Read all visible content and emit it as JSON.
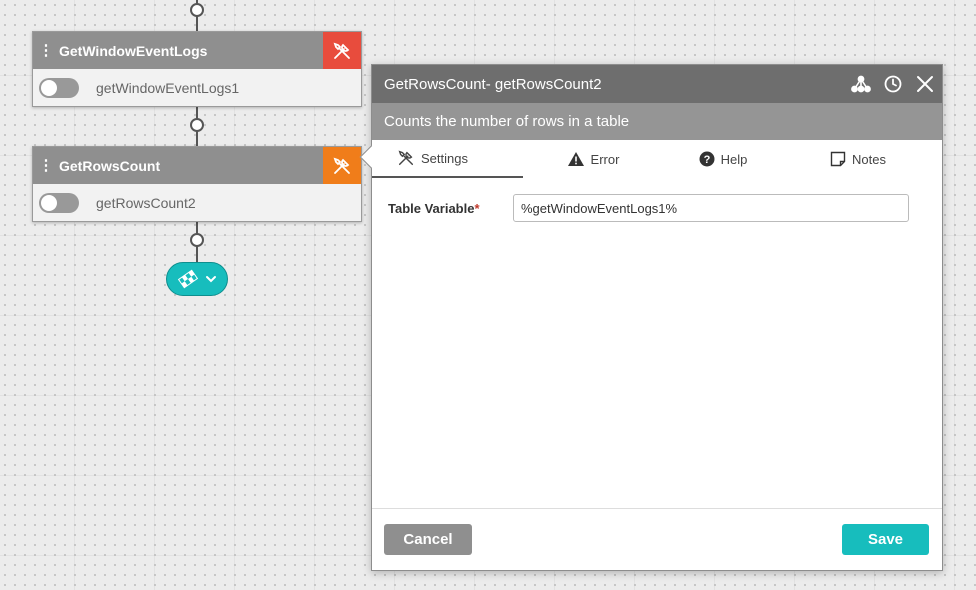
{
  "workflow": {
    "nodes": [
      {
        "title": "GetWindowEventLogs",
        "instance": "getWindowEventLogs1",
        "tool_color": "#e84c3d"
      },
      {
        "title": "GetRowsCount",
        "instance": "getRowsCount2",
        "tool_color": "#f07d1a"
      }
    ],
    "end_color": "#17bdbd"
  },
  "panel": {
    "title": "GetRowsCount-  getRowsCount2",
    "description": "Counts the number of rows in a table",
    "tabs": [
      {
        "label": "Settings",
        "icon": "tools-icon"
      },
      {
        "label": "Error",
        "icon": "warning-icon"
      },
      {
        "label": "Help",
        "icon": "question-circle-icon"
      },
      {
        "label": "Notes",
        "icon": "note-icon"
      }
    ],
    "fields": [
      {
        "label": "Table Variable",
        "required_mark": "*",
        "value": "%getWindowEventLogs1%"
      }
    ],
    "buttons": {
      "cancel": "Cancel",
      "save": "Save"
    }
  }
}
